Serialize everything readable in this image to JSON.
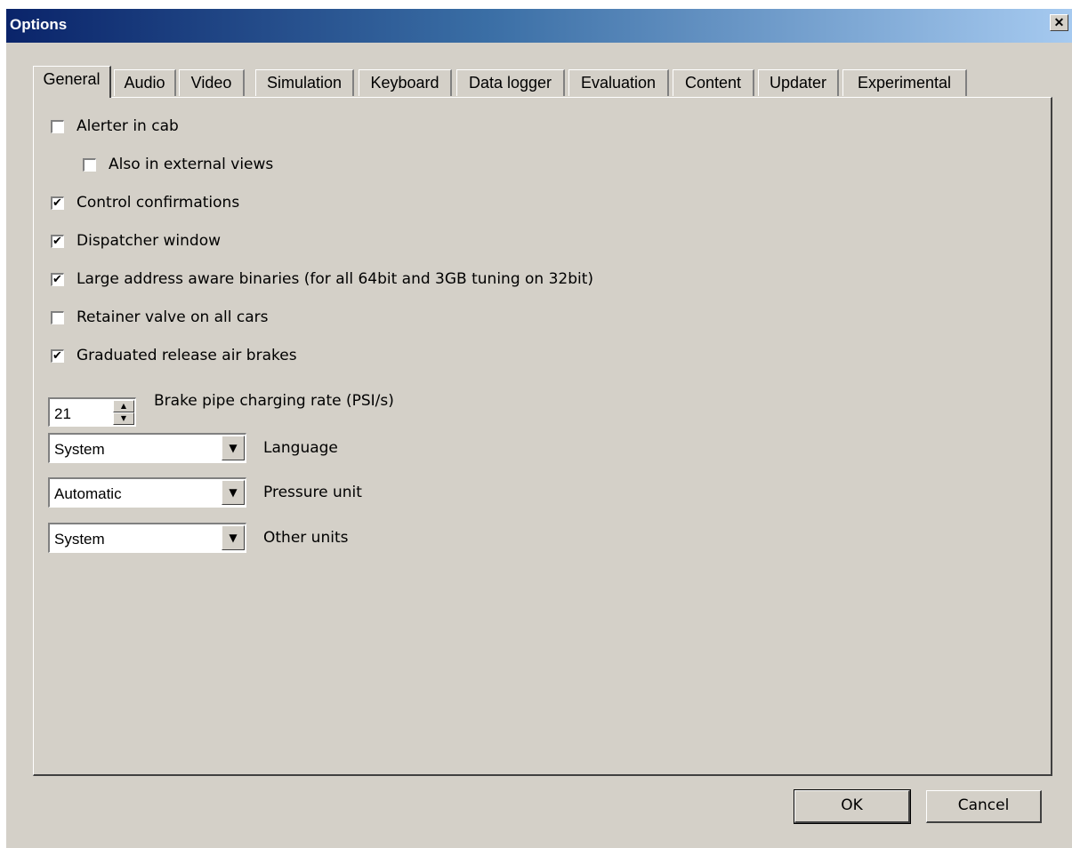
{
  "window": {
    "title": "Options",
    "close_label": "✕"
  },
  "tabs": [
    {
      "label": "General"
    },
    {
      "label": "Audio"
    },
    {
      "label": "Video"
    },
    {
      "label": "Simulation"
    },
    {
      "label": "Keyboard"
    },
    {
      "label": "Data logger"
    },
    {
      "label": "Evaluation"
    },
    {
      "label": "Content"
    },
    {
      "label": "Updater"
    },
    {
      "label": "Experimental"
    }
  ],
  "general": {
    "checkboxes": [
      {
        "label": "Alerter in cab",
        "checked": false
      },
      {
        "label": "Also in external views",
        "checked": false
      },
      {
        "label": "Control confirmations",
        "checked": true
      },
      {
        "label": "Dispatcher window",
        "checked": true
      },
      {
        "label": "Large address aware binaries (for all 64bit and 3GB tuning on 32bit)",
        "checked": true
      },
      {
        "label": "Retainer valve on all cars",
        "checked": false
      },
      {
        "label": "Graduated release air brakes",
        "checked": true
      }
    ],
    "brake_rate": {
      "value": "21",
      "label": "Brake pipe charging rate (PSI/s)"
    },
    "language": {
      "value": "System",
      "label": "Language"
    },
    "pressure_unit": {
      "value": "Automatic",
      "label": "Pressure unit"
    },
    "other_units": {
      "value": "System",
      "label": "Other units"
    }
  },
  "buttons": {
    "ok": "OK",
    "cancel": "Cancel"
  },
  "colors": {
    "face": "#d4d0c8",
    "title_start": "#0a246a",
    "title_end": "#a6caf0"
  }
}
